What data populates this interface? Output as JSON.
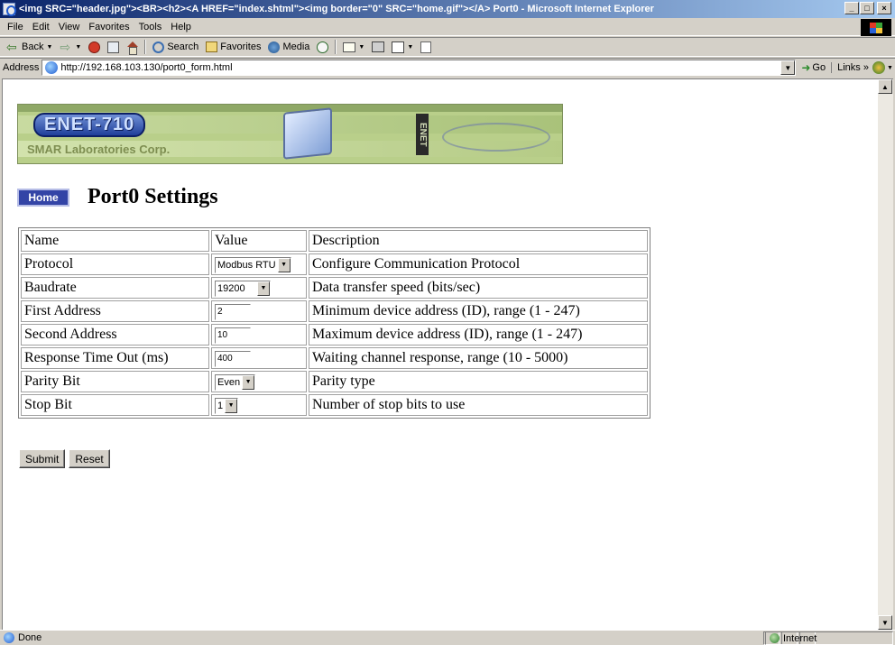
{
  "window": {
    "title": "<img SRC=\"header.jpg\"><BR><h2><A HREF=\"index.shtml\"><img border=\"0\" SRC=\"home.gif\"></A>  Port0 - Microsoft Internet Explorer",
    "minimize": "_",
    "maximize": "□",
    "close": "×"
  },
  "menubar": {
    "items": [
      "File",
      "Edit",
      "View",
      "Favorites",
      "Tools",
      "Help"
    ]
  },
  "toolbar": {
    "back": "Back",
    "search": "Search",
    "favorites": "Favorites",
    "media": "Media"
  },
  "address": {
    "label": "Address",
    "url": "http://192.168.103.130/port0_form.html",
    "go": "Go",
    "links": "Links »"
  },
  "banner": {
    "logo": "ENET-710",
    "company": "SMAR Laboratories Corp.",
    "vertical": "ENET"
  },
  "page": {
    "home_button": "Home",
    "title": "Port0 Settings"
  },
  "table": {
    "headers": {
      "name": "Name",
      "value": "Value",
      "description": "Description"
    },
    "rows": [
      {
        "name": "Protocol",
        "value": "Modbus RTU",
        "description": "Configure Communication Protocol"
      },
      {
        "name": "Baudrate",
        "value": "19200",
        "description": "Data transfer speed (bits/sec)"
      },
      {
        "name": "First Address",
        "value": "2",
        "description": "Minimum device address (ID), range (1 - 247)"
      },
      {
        "name": "Second Address",
        "value": "10",
        "description": "Maximum device address (ID), range (1 - 247)"
      },
      {
        "name": "Response Time Out (ms)",
        "value": "400",
        "description": "Waiting channel response, range (10 - 5000)"
      },
      {
        "name": "Parity Bit",
        "value": "Even",
        "description": "Parity type"
      },
      {
        "name": "Stop Bit",
        "value": "1",
        "description": "Number of stop bits to use"
      }
    ]
  },
  "form": {
    "submit": "Submit",
    "reset": "Reset"
  },
  "status": {
    "text": "Done",
    "zone": "Internet"
  }
}
